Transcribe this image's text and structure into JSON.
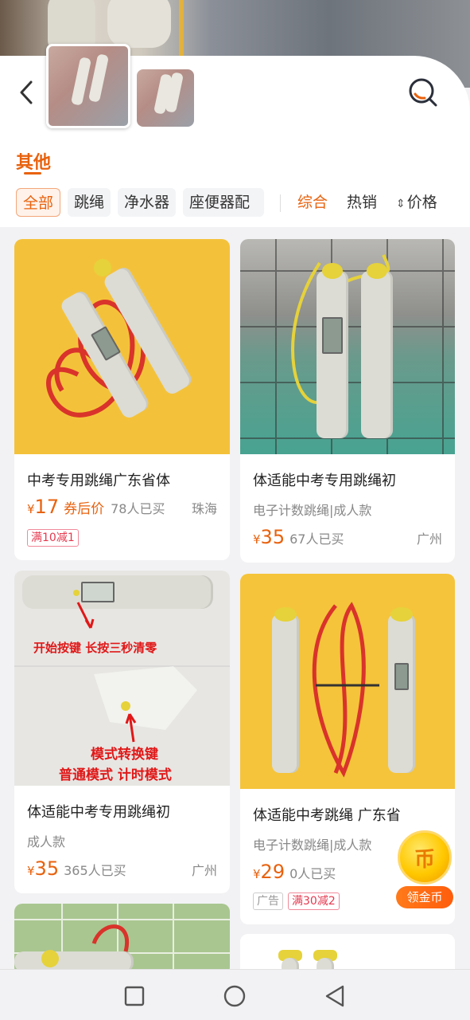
{
  "header": {
    "back_icon": "chevron-left-icon",
    "search_icon": "search-icon"
  },
  "category": {
    "title": "其他"
  },
  "chips": [
    {
      "label": "全部",
      "active": true
    },
    {
      "label": "跳绳",
      "active": false
    },
    {
      "label": "净水器",
      "active": false
    },
    {
      "label": "座便器配",
      "active": false
    }
  ],
  "sorts": [
    {
      "label": "综合",
      "active": true
    },
    {
      "label": "热销",
      "active": false
    },
    {
      "label": "价格",
      "active": false
    }
  ],
  "products": [
    {
      "title": "中考专用跳绳广东省体",
      "yen": "¥",
      "price": "17",
      "coupon_label": "券后价",
      "sold": "78人已买",
      "location": "珠海",
      "tags": [
        "满10减1"
      ]
    },
    {
      "title": "体适能中考专用跳绳初",
      "subtitle": "电子计数跳绳|成人款",
      "yen": "¥",
      "price": "35",
      "sold": "67人已买",
      "location": "广州"
    },
    {
      "title": "体适能中考专用跳绳初",
      "subtitle": "成人款",
      "yen": "¥",
      "price": "35",
      "sold": "365人已买",
      "location": "广州",
      "image_annotations": {
        "line1": "开始按键  长按三秒清零",
        "line2": "模式转换键",
        "line3": "普通模式  计时模式"
      }
    },
    {
      "title": "体适能中考跳绳 广东省",
      "subtitle": "电子计数跳绳|成人款",
      "yen": "¥",
      "price": "29",
      "sold": "0人已买",
      "tags": [
        "广告",
        "满30减2"
      ]
    }
  ],
  "floating_coin": {
    "icon_text": "币",
    "button_label": "领金币"
  },
  "navbar": {
    "recent_icon": "square-icon",
    "home_icon": "circle-icon",
    "back_icon": "triangle-back-icon"
  }
}
